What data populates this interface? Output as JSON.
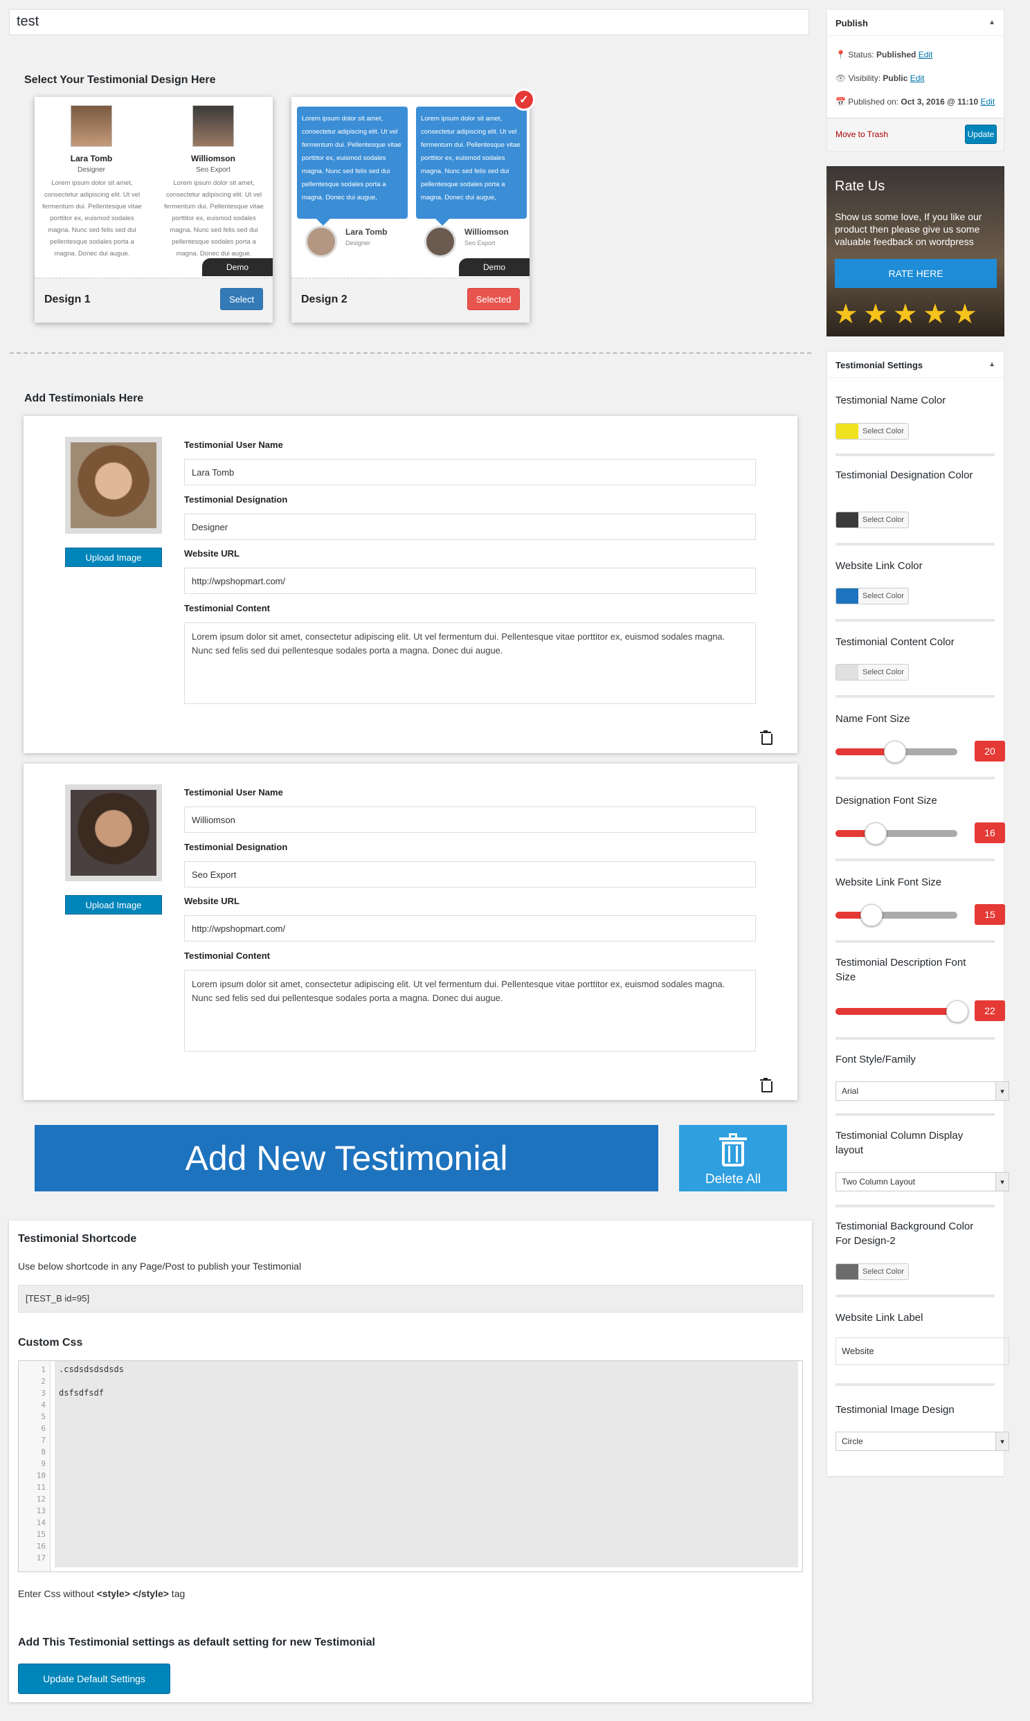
{
  "post_title": "test",
  "designs": {
    "heading": "Select Your Testimonial Design Here",
    "design1": {
      "name": "Design 1",
      "button": "Select",
      "demo": "Demo",
      "people": [
        {
          "name": "Lara Tomb",
          "designation": "Designer"
        },
        {
          "name": "Williomson",
          "designation": "Seo Export"
        }
      ],
      "sample_text": "Lorem ipsum dolor sit amet, consectetur adipiscing elit. Ut vel fermentum dui. Pellentesque vitae porttitor ex, euismod sodales magna. Nunc sed felis sed dui pellentesque sodales porta a magna. Donec dui augue."
    },
    "design2": {
      "name": "Design 2",
      "button": "Selected",
      "demo": "Demo",
      "people": [
        {
          "name": "Lara Tomb",
          "designation": "Designer"
        },
        {
          "name": "Williomson",
          "designation": "Seo Export"
        }
      ],
      "sample_text": "Lorem ipsum dolor sit amet, consectetur adipiscing elit. Ut vel fermentum dui. Pellentesque vitae porttitor ex, euismod sodales magna. Nunc sed felis sed dui pellentesque sodales porta a magna. Donec dui augue,"
    }
  },
  "testimonials": {
    "heading": "Add Testimonials Here",
    "upload_label": "Upload Image",
    "labels": {
      "name": "Testimonial User Name",
      "designation": "Testimonial Designation",
      "url": "Website URL",
      "content": "Testimonial Content"
    },
    "items": [
      {
        "name": "Lara Tomb",
        "designation": "Designer",
        "url": "http://wpshopmart.com/",
        "content": "Lorem ipsum dolor sit amet, consectetur adipiscing elit. Ut vel fermentum dui. Pellentesque vitae porttitor ex, euismod sodales magna. Nunc sed felis sed dui pellentesque sodales porta a magna. Donec dui augue."
      },
      {
        "name": "Williomson",
        "designation": "Seo Export",
        "url": "http://wpshopmart.com/",
        "content": "Lorem ipsum dolor sit amet, consectetur adipiscing elit. Ut vel fermentum dui. Pellentesque vitae porttitor ex, euismod sodales magna. Nunc sed felis sed dui pellentesque sodales porta a magna. Donec dui augue."
      }
    ],
    "add_new": "Add New Testimonial",
    "delete_all": "Delete All"
  },
  "shortcode": {
    "heading": "Testimonial Shortcode",
    "description": "Use below shortcode in any Page/Post to publish your Testimonial",
    "value": "[TEST_B id=95]",
    "css_heading": "Custom Css",
    "css_lines": [
      ".csdsdsdsdsds",
      "",
      "dsfsdfsdf",
      "",
      "",
      "",
      "",
      "",
      "",
      "",
      "",
      "",
      "",
      "",
      "",
      "",
      "",
      ""
    ],
    "line_numbers": [
      "1",
      "2",
      "3",
      "4",
      "5",
      "6",
      "7",
      "8",
      "9",
      "10",
      "11",
      "12",
      "13",
      "14",
      "15",
      "16",
      "17"
    ],
    "css_note_prefix": "Enter Css without ",
    "css_note_tag1": "<style>",
    "css_note_tag2": "</style>",
    "css_note_suffix": " tag",
    "default_heading": "Add This Testimonial settings as default setting for new Testimonial",
    "default_button": "Update Default Settings"
  },
  "publish": {
    "title": "Publish",
    "status_label": "Status:",
    "status_value": "Published",
    "visibility_label": "Visibility:",
    "visibility_value": "Public",
    "published_label": "Published on:",
    "published_value": "Oct 3, 2016 @ 11:10",
    "edit": "Edit",
    "trash": "Move to Trash",
    "update": "Update"
  },
  "rate": {
    "title": "Rate Us",
    "text": "Show us some love, If you like our product then please give us some valuable feedback on wordpress",
    "button": "RATE HERE",
    "stars": 5
  },
  "settings": {
    "title": "Testimonial Settings",
    "select_color": "Select Color",
    "name_color_label": "Testimonial Name Color",
    "name_color": "#f0e21e",
    "designation_color_label": "Testimonial Designation Color",
    "designation_color": "#3b3b3b",
    "link_color_label": "Website Link Color",
    "link_color": "#1e73be",
    "content_color_label": "Testimonial Content Color",
    "content_color": "#e0e0e0",
    "name_size_label": "Name Font Size",
    "name_size": "20",
    "designation_size_label": "Designation Font Size",
    "designation_size": "16",
    "link_size_label": "Website Link Font Size",
    "link_size": "15",
    "desc_size_label": "Testimonial Description Font Size",
    "desc_size": "22",
    "font_label": "Font Style/Family",
    "font_value": "Arial",
    "layout_label": "Testimonial Column Display layout",
    "layout_value": "Two Column Layout",
    "bg_label": "Testimonial Background Color For Design-2",
    "bg_color": "#6b6b6b",
    "link_label_label": "Website Link Label",
    "link_label_value": "Website",
    "image_design_label": "Testimonial Image Design",
    "image_design_value": "Circle"
  }
}
